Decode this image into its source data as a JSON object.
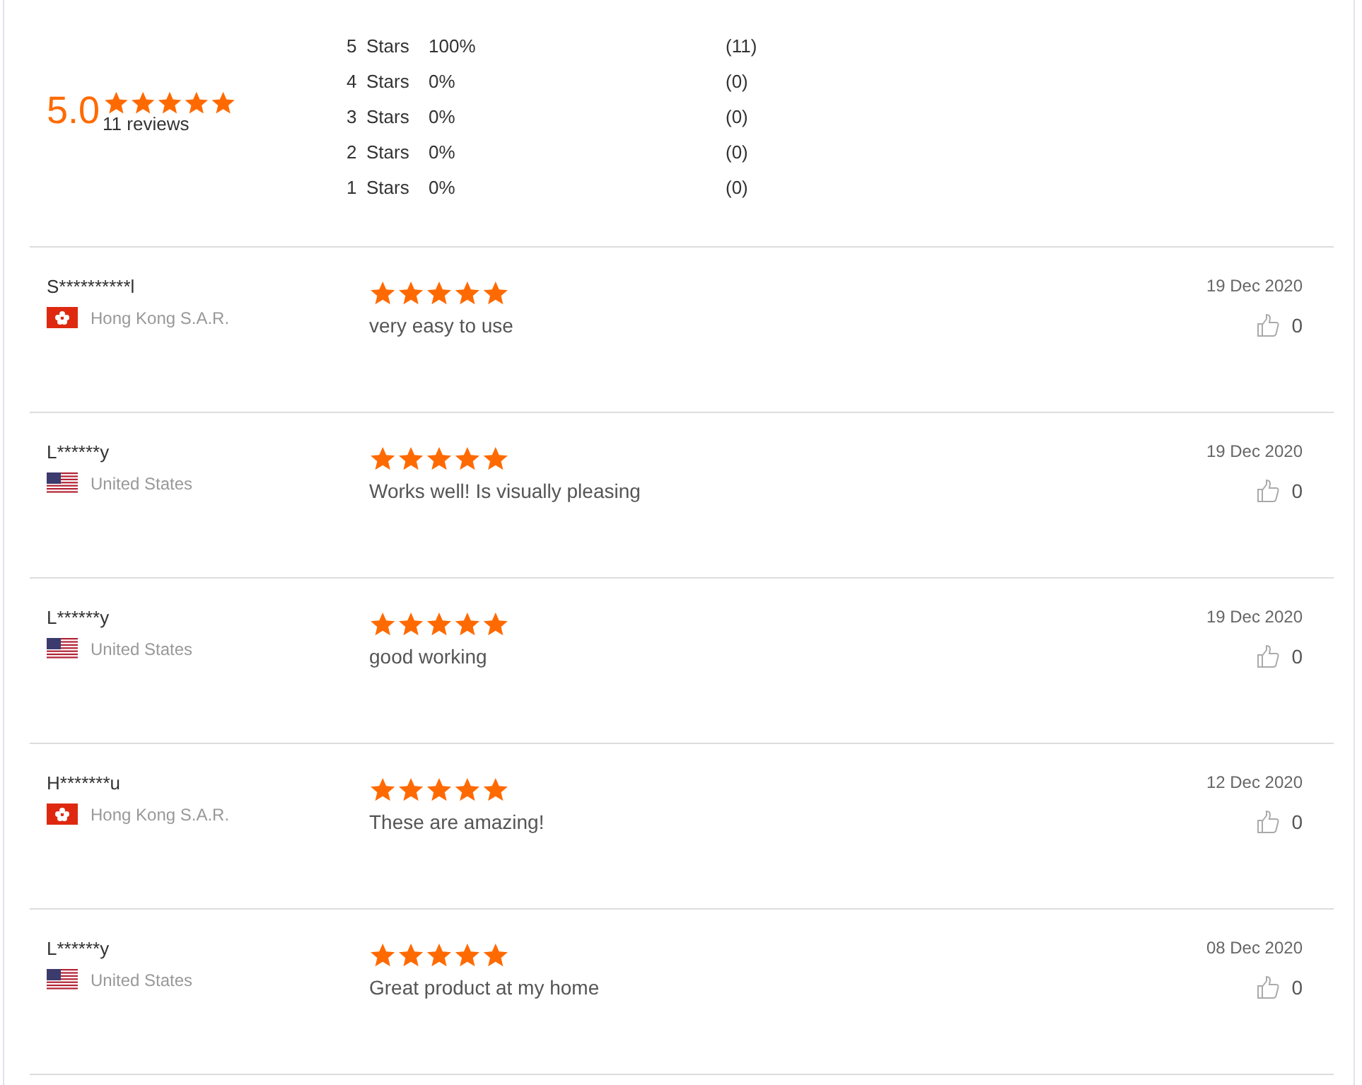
{
  "summary": {
    "score": "5.0",
    "stars": 5,
    "count": "11 reviews"
  },
  "histogram": [
    {
      "stars": "5",
      "label": "Stars",
      "percent": "100%",
      "count": "(11)"
    },
    {
      "stars": "4",
      "label": "Stars",
      "percent": "0%",
      "count": "(0)"
    },
    {
      "stars": "3",
      "label": "Stars",
      "percent": "0%",
      "count": "(0)"
    },
    {
      "stars": "2",
      "label": "Stars",
      "percent": "0%",
      "count": "(0)"
    },
    {
      "stars": "1",
      "label": "Stars",
      "percent": "0%",
      "count": "(0)"
    }
  ],
  "reviews": [
    {
      "name": "S**********l",
      "kind": "hk",
      "country": "Hong Kong S.A.R.",
      "stars": 5,
      "text": "very easy to use",
      "date": "19 Dec 2020",
      "likes": "0"
    },
    {
      "name": "L******y",
      "kind": "us",
      "country": "United States",
      "stars": 5,
      "text": "Works well! Is visually pleasing",
      "date": "19 Dec 2020",
      "likes": "0"
    },
    {
      "name": "L******y",
      "kind": "us",
      "country": "United States",
      "stars": 5,
      "text": "good working",
      "date": "19 Dec 2020",
      "likes": "0"
    },
    {
      "name": "H*******u",
      "kind": "hk",
      "country": "Hong Kong S.A.R.",
      "stars": 5,
      "text": "These are amazing!",
      "date": "12 Dec 2020",
      "likes": "0"
    },
    {
      "name": "L******y",
      "kind": "us",
      "country": "United States",
      "stars": 5,
      "text": "Great product at my home",
      "date": "08 Dec 2020",
      "likes": "0"
    }
  ]
}
